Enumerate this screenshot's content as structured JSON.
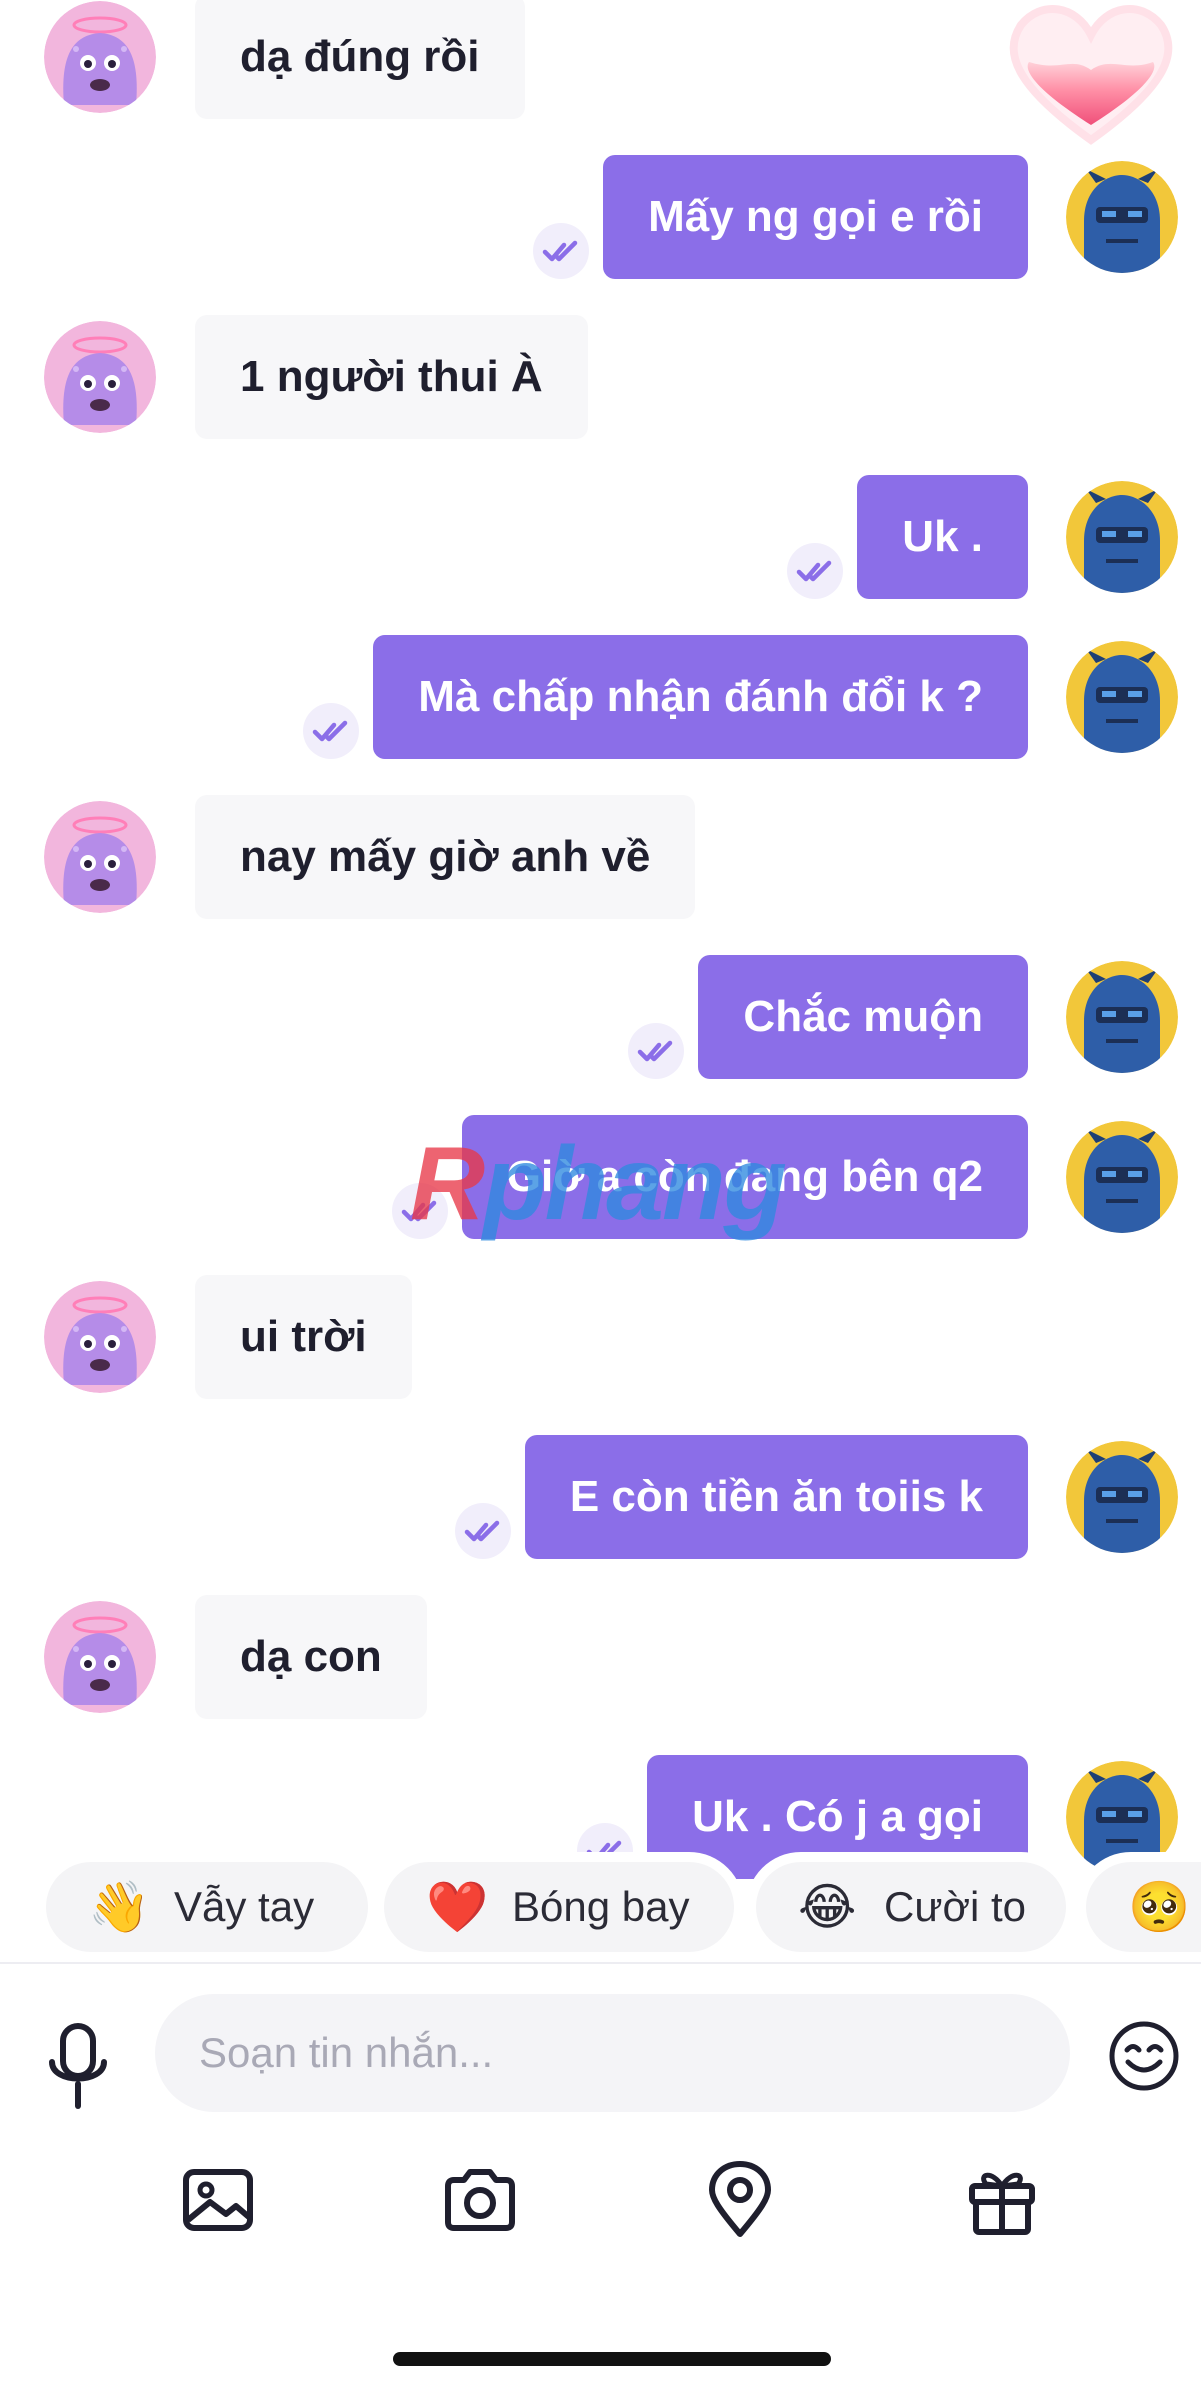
{
  "messages": [
    {
      "dir": "in",
      "text": "dạ đúng rồi"
    },
    {
      "dir": "out",
      "text": "Mấy ng gọi e rồi"
    },
    {
      "dir": "in",
      "text": "1 người thui À"
    },
    {
      "dir": "out",
      "text": "Uk ."
    },
    {
      "dir": "out",
      "text": "Mà chấp nhận đánh đổi k ?"
    },
    {
      "dir": "in",
      "text": "nay mấy giờ anh về"
    },
    {
      "dir": "out",
      "text": "Chắc muộn"
    },
    {
      "dir": "out",
      "text": "Giờ a còn đang bên q2"
    },
    {
      "dir": "in",
      "text": "ui trời"
    },
    {
      "dir": "out",
      "text": "E còn tiền ăn toiis k"
    },
    {
      "dir": "in",
      "text": "dạ con"
    },
    {
      "dir": "out",
      "text": "Uk . Có j a gọi"
    }
  ],
  "watermark": {
    "first": "R",
    "rest": "phang"
  },
  "quick_replies": [
    {
      "emoji": "👋",
      "label": "Vẫy tay"
    },
    {
      "emoji": "❤️",
      "label": "Bóng bay"
    },
    {
      "emoji": "😂",
      "label": "Cười to"
    },
    {
      "emoji": "🥺",
      "label": ""
    }
  ],
  "composer": {
    "placeholder": "Soạn tin nhắn..."
  },
  "toolbar": [
    "image-icon",
    "camera-icon",
    "location-icon",
    "gift-icon"
  ],
  "colors": {
    "accent": "#8b6ee8",
    "incoming_bg": "#f7f7f9",
    "avatar_in": "#f2b6dd",
    "avatar_out": "#f2c73a"
  }
}
